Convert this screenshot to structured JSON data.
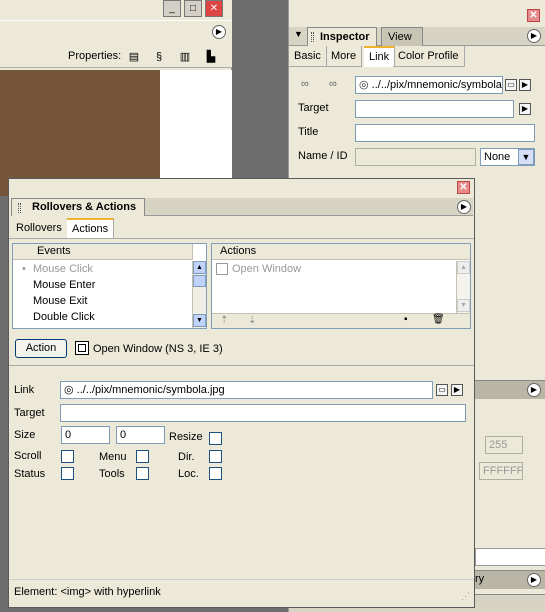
{
  "document_window": {
    "properties_label": "Properties:",
    "icons": [
      "page-icon",
      "link-chain-icon",
      "filmstrip-icon",
      "layers-icon"
    ]
  },
  "inspector": {
    "title": "Inspector",
    "view_tab": "View",
    "tabs": [
      "Basic",
      "More",
      "Link",
      "Color Profile"
    ],
    "active_tab": "Link",
    "link_value": "../../pix/mnemonic/symbola.",
    "target_label": "Target",
    "target_value": "",
    "title_label": "Title",
    "title_value": "",
    "name_id_label": "Name / ID",
    "name_id_value": "",
    "name_select_value": "None",
    "lower_value_255": "255",
    "lower_value_hex": "FFFFFF",
    "lower_bottom_tab_fragment": "ry"
  },
  "rollovers_actions": {
    "title": "Rollovers & Actions",
    "tabs": [
      "Rollovers",
      "Actions"
    ],
    "active_tab": "Actions",
    "events_header": "Events",
    "events": [
      {
        "label": "Mouse Click",
        "state": "disabled",
        "bullet": "•"
      },
      {
        "label": "Mouse Enter",
        "state": "normal",
        "bullet": ""
      },
      {
        "label": "Mouse Exit",
        "state": "normal",
        "bullet": ""
      },
      {
        "label": "Double Click",
        "state": "normal",
        "bullet": ""
      }
    ],
    "actions_header": "Actions",
    "actions": [
      {
        "label": "Open Window",
        "state": "disabled"
      }
    ],
    "action_button": "Action",
    "action_description": "Open Window (NS 3, IE 3)",
    "link_label": "Link",
    "link_value": "../../pix/mnemonic/symbola.jpg",
    "target_label": "Target",
    "target_value": "",
    "size_label": "Size",
    "size_width": "0",
    "size_height": "0",
    "resize_label": "Resize",
    "scroll_label": "Scroll",
    "menu_label": "Menu",
    "dir_label": "Dir.",
    "status_label": "Status",
    "tools_label": "Tools",
    "loc_label": "Loc.",
    "checkboxes": {
      "resize": false,
      "scroll": false,
      "menu": false,
      "dir": false,
      "status": false,
      "tools": false,
      "loc": false
    },
    "status_text": "Element: <img> with hyperlink"
  },
  "colors": {
    "panel_bg": "#ece9d8",
    "canvas_brown": "#76563a",
    "active_tab_accent": "#f0b030",
    "close_red": "#e68a8a"
  }
}
